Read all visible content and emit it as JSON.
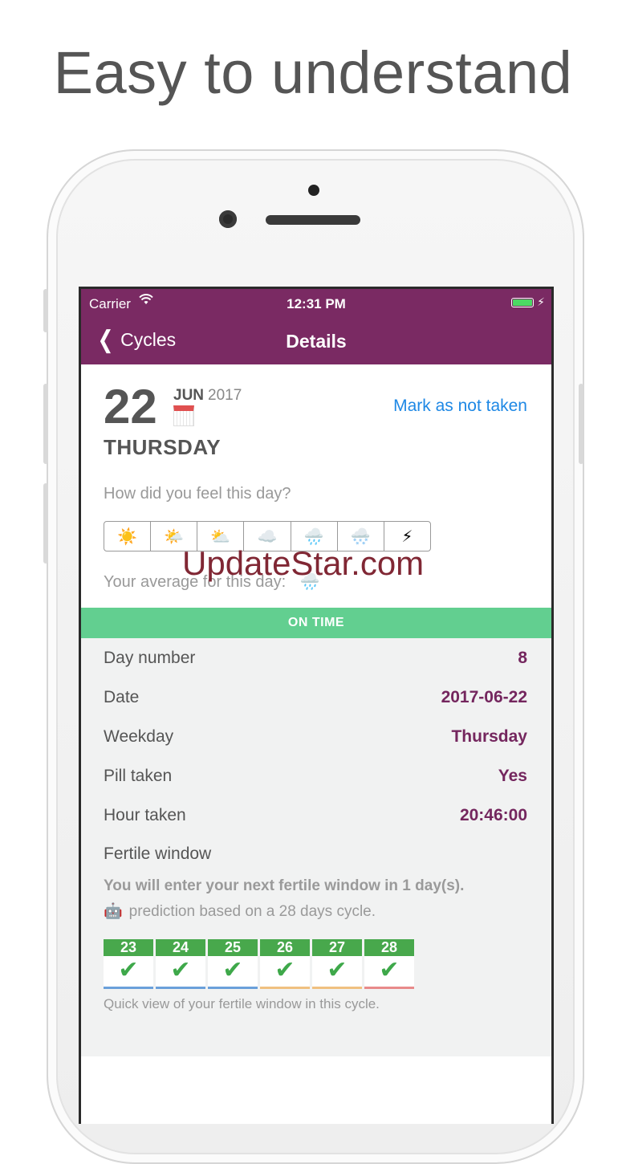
{
  "headline": "Easy to understand",
  "status_bar": {
    "carrier": "Carrier",
    "time": "12:31 PM",
    "wifi_icon": "wifi-icon",
    "battery_color": "#4cd964"
  },
  "nav": {
    "back_label": "Cycles",
    "title": "Details",
    "bar_color": "#7a2a63"
  },
  "date": {
    "day": "22",
    "month": "JUN",
    "year": "2017",
    "weekday": "THURSDAY"
  },
  "mark_link": "Mark as not taken",
  "feel_question": "How did you feel this day?",
  "moods": [
    {
      "icon": "sun-icon",
      "glyph": "☀️"
    },
    {
      "icon": "sun-behind-cloud-icon",
      "glyph": "🌤️"
    },
    {
      "icon": "cloud-sun-icon",
      "glyph": "⛅"
    },
    {
      "icon": "cloud-icon",
      "glyph": "☁️"
    },
    {
      "icon": "rain-cloud-icon",
      "glyph": "🌧️"
    },
    {
      "icon": "snow-cloud-icon",
      "glyph": "🌨️"
    },
    {
      "icon": "lightning-icon",
      "glyph": "⚡"
    }
  ],
  "average_label": "Your average for this day:",
  "average_icon": "🌧️",
  "watermark": "UpdateStar.com",
  "status_banner": {
    "label": "ON TIME",
    "color": "#62cf90"
  },
  "details": [
    {
      "label": "Day number",
      "value": "8"
    },
    {
      "label": "Date",
      "value": "2017-06-22"
    },
    {
      "label": "Weekday",
      "value": "Thursday"
    },
    {
      "label": "Pill taken",
      "value": "Yes"
    },
    {
      "label": "Hour taken",
      "value": "20:46:00"
    }
  ],
  "fertile": {
    "title": "Fertile window",
    "next": "You will enter your next fertile window in 1 day(s).",
    "robot_icon": "🤖",
    "prediction": "prediction based on a 28 days cycle.",
    "days": [
      {
        "num": "23",
        "mark": "✔"
      },
      {
        "num": "24",
        "mark": "✔"
      },
      {
        "num": "25",
        "mark": "✔"
      },
      {
        "num": "26",
        "mark": "✔"
      },
      {
        "num": "27",
        "mark": "✔"
      },
      {
        "num": "28",
        "mark": "✔"
      }
    ],
    "quick_view": "Quick view of your fertile window in this cycle."
  }
}
